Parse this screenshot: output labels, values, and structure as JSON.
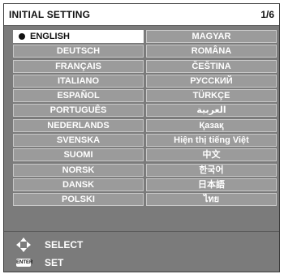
{
  "header": {
    "title": "INITIAL SETTING",
    "page": "1/6"
  },
  "languages_left": [
    {
      "label": "ENGLISH",
      "selected": true
    },
    {
      "label": "DEUTSCH"
    },
    {
      "label": "FRANÇAIS"
    },
    {
      "label": "ITALIANO"
    },
    {
      "label": "ESPAÑOL"
    },
    {
      "label": "PORTUGUÊS"
    },
    {
      "label": "NEDERLANDS"
    },
    {
      "label": "SVENSKA"
    },
    {
      "label": "SUOMI"
    },
    {
      "label": "NORSK"
    },
    {
      "label": "DANSK"
    },
    {
      "label": "POLSKI"
    }
  ],
  "languages_right": [
    {
      "label": "MAGYAR"
    },
    {
      "label": "ROMÂNA"
    },
    {
      "label": "ČEŠTINA"
    },
    {
      "label": "РУССКИЙ"
    },
    {
      "label": "TÜRKÇE"
    },
    {
      "label": "العربية"
    },
    {
      "label": "Қазақ"
    },
    {
      "label": "Hiện thị tiếng Việt"
    },
    {
      "label": "中文"
    },
    {
      "label": "한국어"
    },
    {
      "label": "日本語"
    },
    {
      "label": "ไทย"
    }
  ],
  "legend": {
    "select_label": "SELECT",
    "set_label": "SET",
    "enter_key_text": "ENTER"
  },
  "colors": {
    "panel": "#7b7b7b",
    "cell": "#9b9b9b",
    "selected": "#ffffff"
  }
}
